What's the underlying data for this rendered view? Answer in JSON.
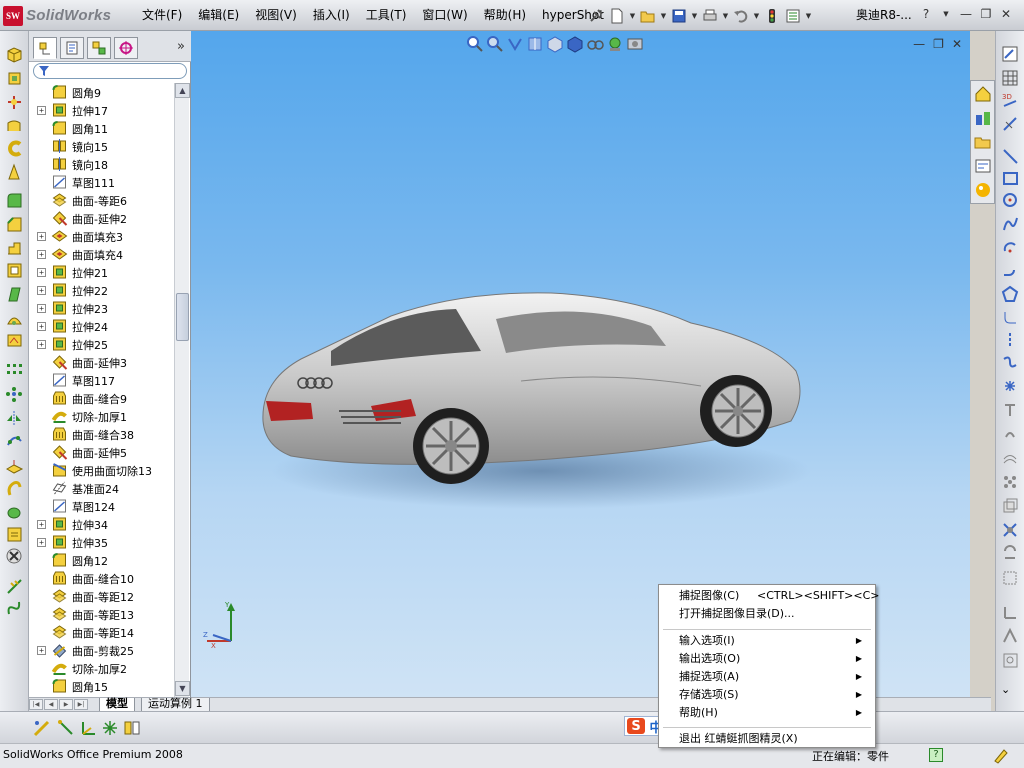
{
  "app": {
    "logo_mark": "SW",
    "logo_text": "SolidWorks",
    "document_title": "奥迪R8-...",
    "help_label": "?"
  },
  "menu": [
    "文件(F)",
    "编辑(E)",
    "视图(V)",
    "插入(I)",
    "工具(T)",
    "窗口(W)",
    "帮助(H)",
    "hyperShot"
  ],
  "feature_tree": {
    "items": [
      {
        "label": "圆角9",
        "expandable": false,
        "icon": "fillet-icon"
      },
      {
        "label": "拉伸17",
        "expandable": true,
        "icon": "extrude-icon"
      },
      {
        "label": "圆角11",
        "expandable": false,
        "icon": "fillet-icon"
      },
      {
        "label": "镜向15",
        "expandable": false,
        "icon": "mirror-icon"
      },
      {
        "label": "镜向18",
        "expandable": false,
        "icon": "mirror-icon"
      },
      {
        "label": "草图111",
        "expandable": false,
        "icon": "sketch-icon"
      },
      {
        "label": "曲面-等距6",
        "expandable": false,
        "icon": "surface-offset-icon"
      },
      {
        "label": "曲面-延伸2",
        "expandable": false,
        "icon": "surface-extend-icon"
      },
      {
        "label": "曲面填充3",
        "expandable": true,
        "icon": "surface-fill-icon"
      },
      {
        "label": "曲面填充4",
        "expandable": true,
        "icon": "surface-fill-icon"
      },
      {
        "label": "拉伸21",
        "expandable": true,
        "icon": "extrude-icon"
      },
      {
        "label": "拉伸22",
        "expandable": true,
        "icon": "extrude-icon"
      },
      {
        "label": "拉伸23",
        "expandable": true,
        "icon": "extrude-icon"
      },
      {
        "label": "拉伸24",
        "expandable": true,
        "icon": "extrude-icon"
      },
      {
        "label": "拉伸25",
        "expandable": true,
        "icon": "extrude-icon"
      },
      {
        "label": "曲面-延伸3",
        "expandable": false,
        "icon": "surface-extend-icon"
      },
      {
        "label": "草图117",
        "expandable": false,
        "icon": "sketch-icon"
      },
      {
        "label": "曲面-缝合9",
        "expandable": false,
        "icon": "surface-knit-icon"
      },
      {
        "label": "切除-加厚1",
        "expandable": false,
        "icon": "thicken-cut-icon"
      },
      {
        "label": "曲面-缝合38",
        "expandable": false,
        "icon": "surface-knit-icon"
      },
      {
        "label": "曲面-延伸5",
        "expandable": false,
        "icon": "surface-extend-icon"
      },
      {
        "label": "使用曲面切除13",
        "expandable": false,
        "icon": "surface-cut-icon"
      },
      {
        "label": "基准面24",
        "expandable": false,
        "icon": "plane-icon"
      },
      {
        "label": "草图124",
        "expandable": false,
        "icon": "sketch-icon"
      },
      {
        "label": "拉伸34",
        "expandable": true,
        "icon": "extrude-icon"
      },
      {
        "label": "拉伸35",
        "expandable": true,
        "icon": "extrude-icon"
      },
      {
        "label": "圆角12",
        "expandable": false,
        "icon": "fillet-icon"
      },
      {
        "label": "曲面-缝合10",
        "expandable": false,
        "icon": "surface-knit-icon"
      },
      {
        "label": "曲面-等距12",
        "expandable": false,
        "icon": "surface-offset-icon"
      },
      {
        "label": "曲面-等距13",
        "expandable": false,
        "icon": "surface-offset-icon"
      },
      {
        "label": "曲面-等距14",
        "expandable": false,
        "icon": "surface-offset-icon"
      },
      {
        "label": "曲面-剪裁25",
        "expandable": true,
        "icon": "surface-trim-icon"
      },
      {
        "label": "切除-加厚2",
        "expandable": false,
        "icon": "thicken-cut-icon"
      },
      {
        "label": "圆角15",
        "expandable": false,
        "icon": "fillet-icon"
      }
    ]
  },
  "bottom_tabs": {
    "model": "模型",
    "motion": "运动算例 1"
  },
  "context_menu": {
    "capture": "捕捉图像(C)",
    "capture_shortcut": "<CTRL><SHIFT><C>",
    "open_dir": "打开捕捉图像目录(D)...",
    "input": "输入选项(I)",
    "output": "输出选项(O)",
    "capture_opts": "捕捉选项(A)",
    "save_opts": "存储选项(S)",
    "help": "帮助(H)",
    "exit": "退出 红蜻蜓抓图精灵(X)"
  },
  "ime": {
    "brand": "S",
    "mode": "中"
  },
  "status": {
    "left": "SolidWorks Office Premium 2008",
    "right": "正在编辑：零件",
    "help": "?"
  },
  "colors": {
    "viewport_top": "#54a6ec",
    "viewport_bottom": "#cfe3f5",
    "accent_red": "#c8102e"
  }
}
